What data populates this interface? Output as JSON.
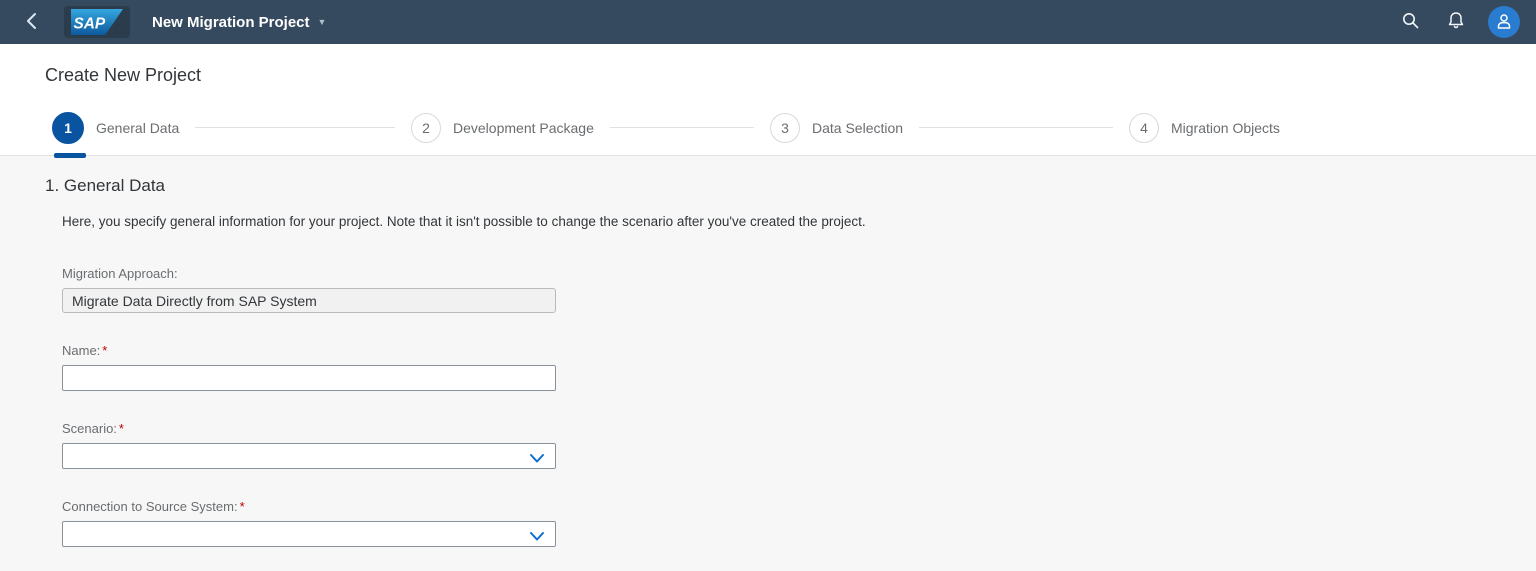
{
  "shell": {
    "app_title": "New Migration Project",
    "icons": [
      "back-icon",
      "sap-logo",
      "chevron-down",
      "search-icon",
      "bell-icon",
      "avatar-person-icon"
    ]
  },
  "page": {
    "title": "Create New Project"
  },
  "wizard": {
    "steps": [
      {
        "number": "1",
        "label": "General Data",
        "active": true
      },
      {
        "number": "2",
        "label": "Development Package",
        "active": false
      },
      {
        "number": "3",
        "label": "Data Selection",
        "active": false
      },
      {
        "number": "4",
        "label": "Migration Objects",
        "active": false
      }
    ]
  },
  "section": {
    "heading": "1. General Data",
    "description": "Here, you specify general information for your project. Note that it isn't possible to change the scenario after you've created the project."
  },
  "form": {
    "fields": [
      {
        "label": "Migration Approach:",
        "required_mark": "",
        "value": "Migrate Data Directly from SAP System",
        "type": "readonly"
      },
      {
        "label": "Name:",
        "required_mark": "*",
        "value": "",
        "type": "text"
      },
      {
        "label": "Scenario:",
        "required_mark": "*",
        "value": "",
        "type": "select"
      },
      {
        "label": "Connection to Source System:",
        "required_mark": "*",
        "value": "",
        "type": "select"
      }
    ]
  },
  "colors": {
    "shell_bg": "#354a5f",
    "accent_blue": "#0a6ed1",
    "active_step_blue": "#0854a0",
    "avatar_blue": "#2a7cd0",
    "required_red": "#bb0000",
    "content_bg": "#f7f7f7"
  }
}
